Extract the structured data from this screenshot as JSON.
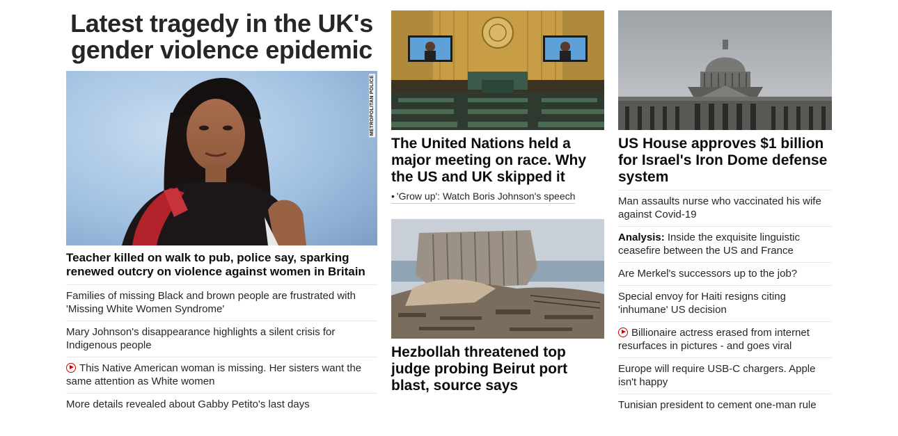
{
  "lead": {
    "zone_title_line1": "Latest tragedy in the UK's",
    "zone_title_line2": "gender violence epidemic",
    "image_credit": "METROPOLITAN POLICE",
    "headline": "Teacher killed on walk to pub, police say, sparking renewed outcry on violence against women in Britain",
    "links": [
      {
        "text": "Families of missing Black and brown people are frustrated with 'Missing White Women Syndrome'",
        "video": false
      },
      {
        "text": "Mary Johnson's disappearance highlights a silent crisis for Indigenous people",
        "video": false
      },
      {
        "text": "This Native American woman is missing. Her sisters want the same attention as White women",
        "video": true
      },
      {
        "text": "More details revealed about Gabby Petito's last days",
        "video": false
      }
    ]
  },
  "un_story": {
    "headline": "The United Nations held a major meeting on race. Why the US and UK skipped it",
    "sub_bullet": "•",
    "sub_link": "'Grow up': Watch Boris Johnson's speech"
  },
  "beirut_story": {
    "headline": "Hezbollah threatened top judge probing Beirut port blast, source says"
  },
  "us_story": {
    "headline": "US House approves $1 billion for Israel's Iron Dome defense system",
    "links": [
      {
        "prefix": "",
        "text": "Man assaults nurse who vaccinated his wife against Covid-19",
        "video": false
      },
      {
        "prefix": "Analysis:",
        "text": " Inside the exquisite linguistic ceasefire between the US and France",
        "video": false
      },
      {
        "prefix": "",
        "text": "Are Merkel's successors up to the job?",
        "video": false
      },
      {
        "prefix": "",
        "text": "Special envoy for Haiti resigns citing 'inhumane' US decision",
        "video": false
      },
      {
        "prefix": "",
        "text": "Billionaire actress erased from internet resurfaces in pictures - and goes viral",
        "video": true
      },
      {
        "prefix": "",
        "text": "Europe will require USB-C chargers. Apple isn't happy",
        "video": false
      },
      {
        "prefix": "",
        "text": "Tunisian president to cement one-man rule",
        "video": false
      }
    ]
  },
  "colors": {
    "accent_red": "#cc0000",
    "text": "#0c0c0c",
    "divider": "#e6e6e6"
  }
}
